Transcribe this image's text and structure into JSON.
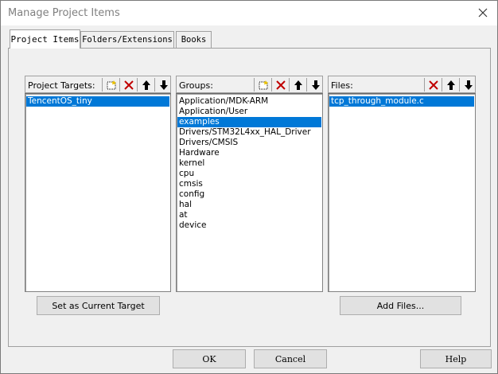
{
  "window": {
    "title": "Manage Project Items"
  },
  "tabs": [
    {
      "label": "Project Items",
      "active": true
    },
    {
      "label": "Folders/Extensions",
      "active": false
    },
    {
      "label": "Books",
      "active": false
    }
  ],
  "targets": {
    "header": "Project Targets:",
    "items": [
      "TencentOS_tiny"
    ],
    "selected_index": 0,
    "set_current_button": "Set as Current Target"
  },
  "groups": {
    "header": "Groups:",
    "items": [
      "Application/MDK-ARM",
      "Application/User",
      "examples",
      "Drivers/STM32L4xx_HAL_Driver",
      "Drivers/CMSIS",
      "Hardware",
      "kernel",
      "cpu",
      "cmsis",
      "config",
      "hal",
      "at",
      "device"
    ],
    "selected_index": 2
  },
  "files": {
    "header": "Files:",
    "items": [
      "tcp_through_module.c"
    ],
    "selected_index": 0,
    "add_files_button": "Add Files..."
  },
  "footer": {
    "ok": "OK",
    "cancel": "Cancel",
    "help": "Help"
  },
  "colors": {
    "selection": "#0078d7",
    "delete_icon": "#c00000"
  }
}
